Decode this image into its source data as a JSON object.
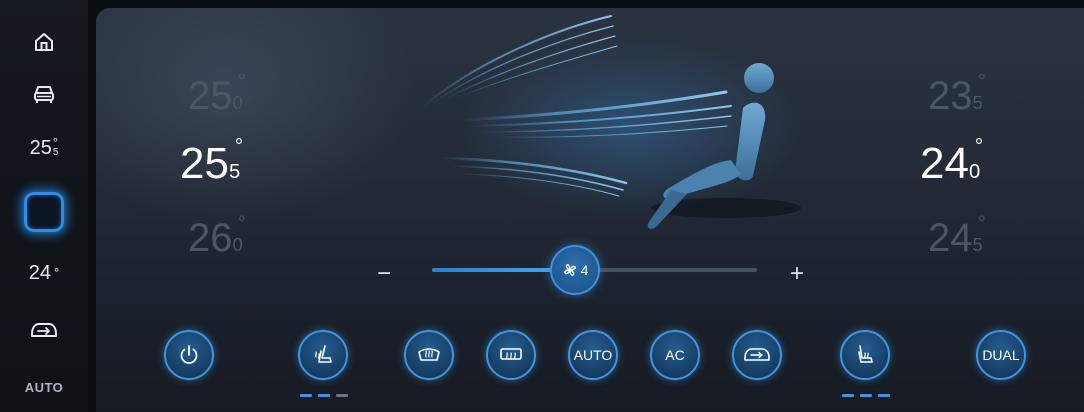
{
  "sidebar": {
    "driver_temp": {
      "int": "25",
      "frac": "5",
      "deg": "°"
    },
    "passenger_temp": {
      "int": "24",
      "deg": "°"
    },
    "auto_label": "AUTO"
  },
  "left_temps": {
    "upper": {
      "int": "25",
      "frac": "0",
      "deg": "°"
    },
    "current": {
      "int": "25",
      "frac": "5",
      "deg": "°"
    },
    "lower": {
      "int": "26",
      "frac": "0",
      "deg": "°"
    }
  },
  "right_temps": {
    "upper": {
      "int": "23",
      "frac": "5",
      "deg": "°"
    },
    "current": {
      "int": "24",
      "frac": "0",
      "deg": "°"
    },
    "lower": {
      "int": "24",
      "frac": "5",
      "deg": "°"
    }
  },
  "fan": {
    "minus": "−",
    "plus": "+",
    "level": "4",
    "level_fraction": 0.44
  },
  "buttons": {
    "auto": "AUTO",
    "ac": "AC",
    "dual": "DUAL"
  },
  "indicators": {
    "driver_seat_heat_levels_on": 2,
    "passenger_seat_heat_levels_on": 3,
    "levels_total": 3
  },
  "colors": {
    "accent": "#3f95e3",
    "accent_glow": "#2a8de6",
    "panel_bg": "#242b37"
  },
  "icons": [
    "home-icon",
    "car-icon",
    "climate-icon",
    "recirculation-icon",
    "power-icon",
    "seat-heat-icon",
    "front-defrost-icon",
    "rear-defrost-icon",
    "fan-icon",
    "recirculation-icon",
    "seat-heat-icon"
  ]
}
